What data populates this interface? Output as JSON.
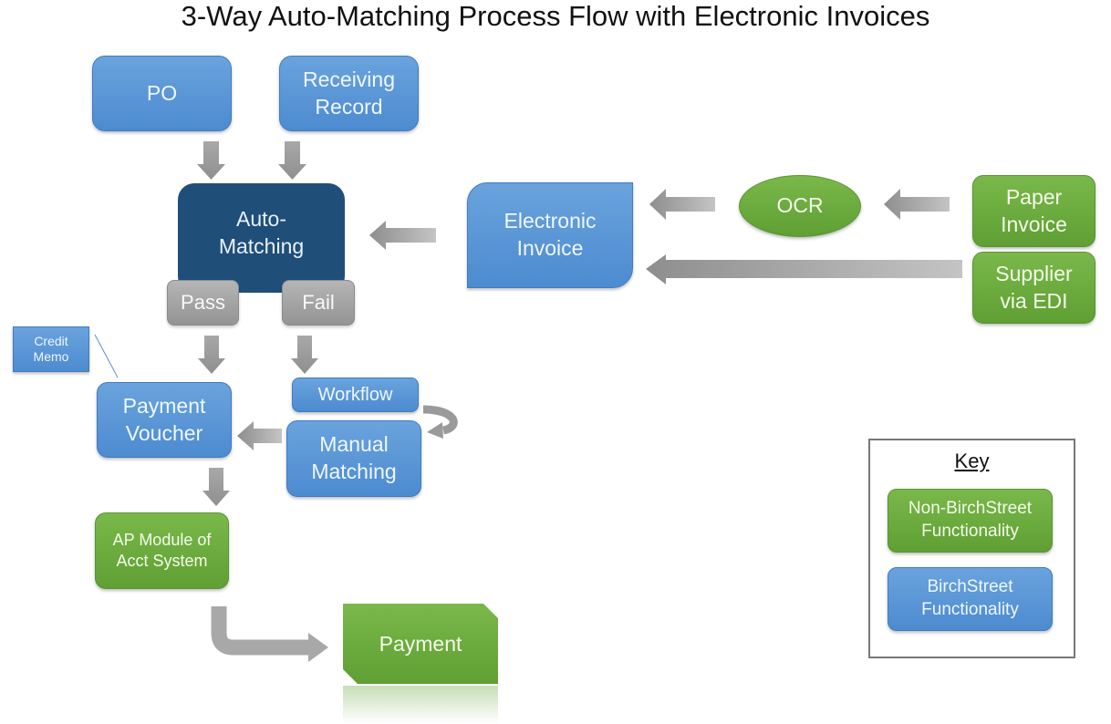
{
  "title": "3-Way Auto-Matching Process Flow with Electronic Invoices",
  "colors": {
    "birchstreet_blue": "#5b9bd5",
    "non_birchstreet_green": "#70ad47",
    "auto_matching_navy": "#1f4e79",
    "result_grey": "#a5a5a5",
    "arrow_grey": "#a6a6a6"
  },
  "nodes": {
    "po": "PO",
    "receiving_record": "Receiving Record",
    "auto_matching_line1": "Auto-",
    "auto_matching_line2": "Matching",
    "pass": "Pass",
    "fail": "Fail",
    "electronic_invoice_line1": "Electronic",
    "electronic_invoice_line2": "Invoice",
    "ocr": "OCR",
    "paper_invoice_line1": "Paper",
    "paper_invoice_line2": "Invoice",
    "supplier_edi_line1": "Supplier",
    "supplier_edi_line2": "via EDI",
    "credit_memo_line1": "Credit",
    "credit_memo_line2": "Memo",
    "payment_voucher_line1": "Payment",
    "payment_voucher_line2": "Voucher",
    "workflow": "Workflow",
    "manual_matching_line1": "Manual",
    "manual_matching_line2": "Matching",
    "ap_module_line1": "AP Module of",
    "ap_module_line2": "Acct System",
    "payment": "Payment"
  },
  "key": {
    "title": "Key",
    "non_birchstreet_line1": "Non-BirchStreet",
    "non_birchstreet_line2": "Functionality",
    "birchstreet_line1": "BirchStreet",
    "birchstreet_line2": "Functionality"
  }
}
